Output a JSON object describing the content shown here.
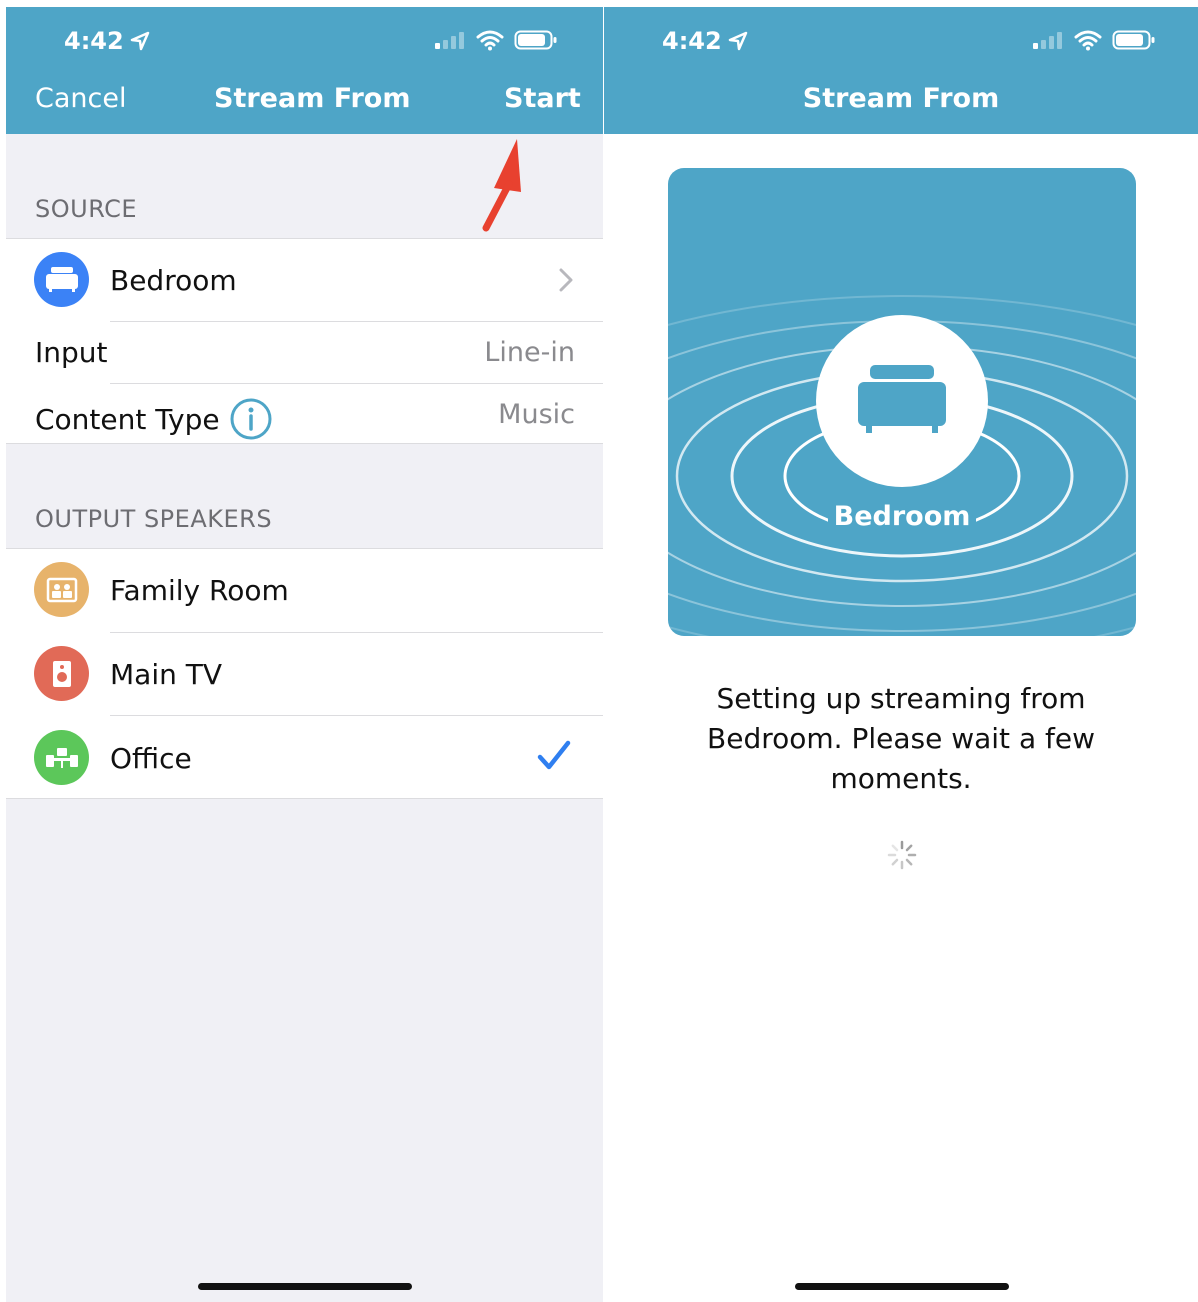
{
  "left_screen": {
    "status_bar": {
      "time": "4:42"
    },
    "nav": {
      "cancel_label": "Cancel",
      "title": "Stream From",
      "start_label": "Start"
    },
    "source": {
      "header": "SOURCE",
      "speaker": {
        "label": "Bedroom",
        "icon": "bedroom-speaker-icon",
        "color": "#3b82f6"
      },
      "input": {
        "label": "Input",
        "value": "Line-in"
      },
      "content_type": {
        "label": "Content Type",
        "value": "Music"
      }
    },
    "output": {
      "header": "OUTPUT SPEAKERS",
      "speakers": [
        {
          "label": "Family Room",
          "icon": "family-room-icon",
          "color": "#e7b36b",
          "checked": false
        },
        {
          "label": "Main TV",
          "icon": "tv-speaker-icon",
          "color": "#e16a57",
          "checked": false
        },
        {
          "label": "Office",
          "icon": "office-icon",
          "color": "#5cc75a",
          "checked": true
        }
      ]
    },
    "annotation_arrow_color": "#e8412f"
  },
  "right_screen": {
    "status_bar": {
      "time": "4:42"
    },
    "nav": {
      "title": "Stream From"
    },
    "illustration": {
      "speaker_name": "Bedroom"
    },
    "message": {
      "line1": "Setting up streaming from",
      "line2": "Bedroom. Please wait a few",
      "line3": "moments."
    }
  },
  "colors": {
    "nav_bar": "#4ea5c7",
    "accent_blue": "#2f7ff0",
    "background": "#f0f0f5"
  }
}
